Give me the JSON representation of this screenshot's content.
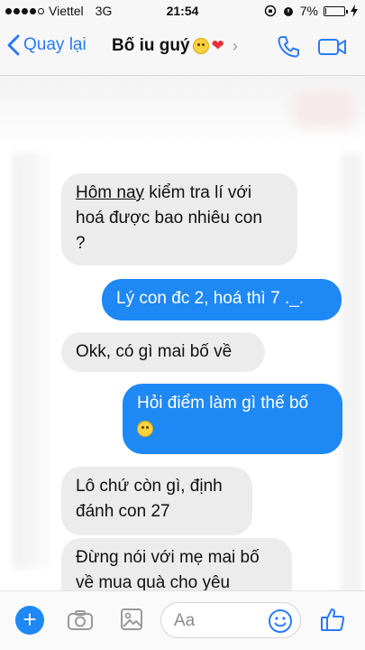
{
  "status": {
    "carrier": "Viettel",
    "network": "3G",
    "time": "21:54",
    "battery": "7%",
    "battery_level": 0.07
  },
  "header": {
    "back_label": "Quay lại",
    "contact_name": "Bố iu guý",
    "icons": [
      "chevron-left-icon",
      "smile-emoji-icon",
      "heart-icon",
      "chevron-right-icon",
      "phone-icon",
      "video-camera-icon"
    ]
  },
  "messages": [
    {
      "side": "in",
      "line1_underlined": "Hôm nay",
      "line1_rest": " kiểm tra lí với",
      "line2": "hoá được bao nhiêu con",
      "line3": "?"
    },
    {
      "side": "out",
      "text": "Lý con đc 2, hoá thì 7 ._."
    },
    {
      "side": "in",
      "text": "Okk, có gì mai bố về"
    },
    {
      "side": "out",
      "text": "Hỏi điểm làm gì thế bố"
    },
    {
      "side": "in",
      "line1": "Lô chứ còn gì, định",
      "line2": "đánh con 27"
    },
    {
      "side": "in",
      "line1": "Đừng nói với mẹ mai bố",
      "line2": "về mua quà cho yêu"
    }
  ],
  "composer": {
    "placeholder": "Aa",
    "accent": "#1e88f5",
    "icons": [
      "plus-icon",
      "camera-icon",
      "image-icon",
      "emoji-icon",
      "thumbs-up-icon"
    ]
  },
  "colors": {
    "accent": "#1e88f5",
    "link": "#2a7bf6",
    "incoming_bubble": "#ececec"
  }
}
